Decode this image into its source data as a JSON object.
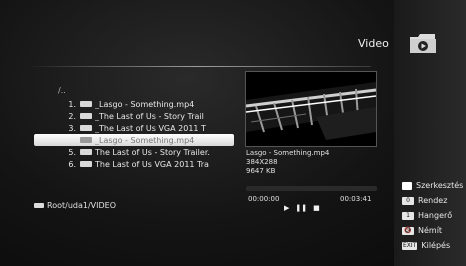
{
  "header": {
    "title": "Video",
    "icon": "video-folder-icon"
  },
  "file_list": {
    "parent_label": "/..",
    "items": [
      {
        "num": "1.",
        "name": "_Lasgo - Something.mp4",
        "selected": false
      },
      {
        "num": "2.",
        "name": "_The Last of Us - Story Trail",
        "selected": false
      },
      {
        "num": "3.",
        "name": "_The Last of Us VGA 2011 T",
        "selected": false
      },
      {
        "num": "",
        "name": "_Lasgo - Something.mp4",
        "selected": true
      },
      {
        "num": "5.",
        "name": "The Last of Us - Story Trailer.",
        "selected": false
      },
      {
        "num": "6.",
        "name": "The Last of Us VGA 2011 Tra",
        "selected": false
      }
    ]
  },
  "preview": {
    "filename": "Lasgo - Something.mp4",
    "resolution": "384X288",
    "size": "9647 KB"
  },
  "playback": {
    "elapsed": "00:00:00",
    "total": "00:03:41",
    "progress": 0.0
  },
  "path": {
    "text": "Root/uda1/VIDEO"
  },
  "legend": {
    "items": [
      {
        "key": "",
        "label": "Szerkesztés"
      },
      {
        "key": "0",
        "label": "Rendez"
      },
      {
        "key": "1",
        "label": "Hangerő"
      },
      {
        "key": "🔇",
        "label": "Némít"
      },
      {
        "key": "EXIT",
        "label": "Kilépés"
      }
    ]
  }
}
